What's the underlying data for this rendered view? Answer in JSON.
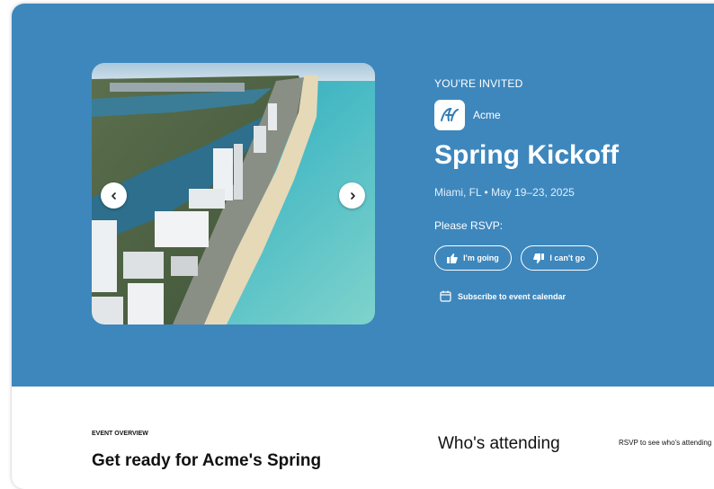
{
  "hero": {
    "eyebrow": "YOU'RE INVITED",
    "brand": {
      "name": "Acme",
      "logo_icon": "acme-script-a-logo"
    },
    "title": "Spring Kickoff",
    "meta": "Miami, FL • May 19–23, 2025",
    "rsvp_label": "Please RSVP:",
    "going_label": "I'm going",
    "cant_go_label": "I can't go",
    "subscribe_label": "Subscribe to event calendar",
    "photo": {
      "subject": "aerial view of Miami Beach coastline"
    },
    "carousel": {
      "prev_icon": "chevron-left-icon",
      "next_icon": "chevron-right-icon"
    }
  },
  "overview": {
    "eyebrow": "EVENT OVERVIEW",
    "heading": "Get ready for Acme's Spring"
  },
  "attending": {
    "title": "Who's attending",
    "note": "RSVP to see who's attending"
  },
  "colors": {
    "hero_bg": "#3d87bd",
    "text_on_hero": "#ffffff",
    "page_bg": "#ffffff"
  }
}
